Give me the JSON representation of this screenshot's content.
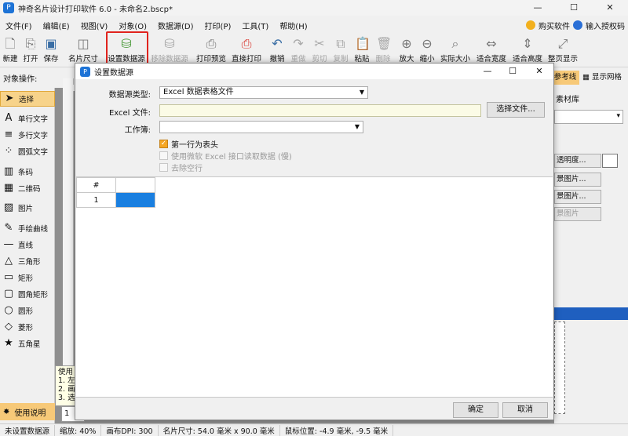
{
  "window": {
    "title": "神奇名片设计打印软件 6.0 - 未命名2.bscp*",
    "app_icon_text": "P",
    "controls": [
      "—",
      "☐",
      "✕"
    ]
  },
  "menu": {
    "items": [
      "文件(F)",
      "编辑(E)",
      "视图(V)",
      "对象(O)",
      "数据源(D)",
      "打印(P)",
      "工具(T)",
      "帮助(H)"
    ],
    "buy": "购买软件",
    "license": "输入授权码"
  },
  "toolbar": {
    "items": [
      {
        "label": "新建",
        "icon": "new-file-icon"
      },
      {
        "label": "打开",
        "icon": "open-icon"
      },
      {
        "label": "保存",
        "icon": "save-icon"
      },
      {
        "label": "名片尺寸",
        "icon": "card-size-icon"
      },
      {
        "label": "设置数据源",
        "icon": "datasource-icon"
      },
      {
        "label": "移除数据源",
        "icon": "remove-datasource-icon"
      },
      {
        "label": "打印预览",
        "icon": "print-preview-icon"
      },
      {
        "label": "直接打印",
        "icon": "print-icon"
      },
      {
        "label": "撤销",
        "icon": "undo-icon"
      },
      {
        "label": "重做",
        "icon": "redo-icon"
      },
      {
        "label": "剪切",
        "icon": "cut-icon"
      },
      {
        "label": "复制",
        "icon": "copy-icon"
      },
      {
        "label": "粘贴",
        "icon": "paste-icon"
      },
      {
        "label": "删除",
        "icon": "delete-icon"
      },
      {
        "label": "放大",
        "icon": "zoom-in-icon"
      },
      {
        "label": "缩小",
        "icon": "zoom-out-icon"
      },
      {
        "label": "实际大小",
        "icon": "actual-size-icon"
      },
      {
        "label": "适合宽度",
        "icon": "fit-width-icon"
      },
      {
        "label": "适合高度",
        "icon": "fit-height-icon"
      },
      {
        "label": "整页显示",
        "icon": "full-page-icon"
      }
    ],
    "disabled": [
      "移除数据源",
      "重做",
      "剪切",
      "复制",
      "删除"
    ]
  },
  "object_ops_label": "对象操作:",
  "left_tools": [
    "选择",
    "单行文字",
    "多行文字",
    "圆弧文字",
    "条码",
    "二维码",
    "图片",
    "手绘曲线",
    "直线",
    "三角形",
    "矩形",
    "圆角矩形",
    "圆形",
    "菱形",
    "五角星"
  ],
  "help_tab": "使用说明",
  "tooltip_lines": [
    "使用",
    "1. 左",
    "2. 画",
    "3. 选"
  ],
  "bottom_tab": "1",
  "right_panel": {
    "tab_ref": "参考线",
    "tab_grid": "显示网格",
    "library": "素材库",
    "btn_opacity": "透明度...",
    "btn_bg1": "景图片...",
    "btn_bg2": "景图片...",
    "btn_bg3": "景图片"
  },
  "status": {
    "datasource": "未设置数据源",
    "zoom": "缩放: 40%",
    "dpi": "画布DPI: 300",
    "size": "名片尺寸: 54.0 毫米 x 90.0 毫米",
    "mouse": "鼠标位置: -4.9 毫米, -9.5 毫米"
  },
  "dialog": {
    "title": "设置数据源",
    "type_label": "数据源类型:",
    "type_value": "Excel 数据表格文件",
    "excel_label": "Excel 文件:",
    "excel_value": "",
    "choose_btn": "选择文件...",
    "sheet_label": "工作簿:",
    "sheet_value": "",
    "opt_header": "第一行为表头",
    "opt_ms": "使用微软 Excel 接口读取数据 (慢)",
    "opt_blank": "去除空行",
    "grid_header": "#",
    "grid_row": "1",
    "ok": "确定",
    "cancel": "取消"
  }
}
